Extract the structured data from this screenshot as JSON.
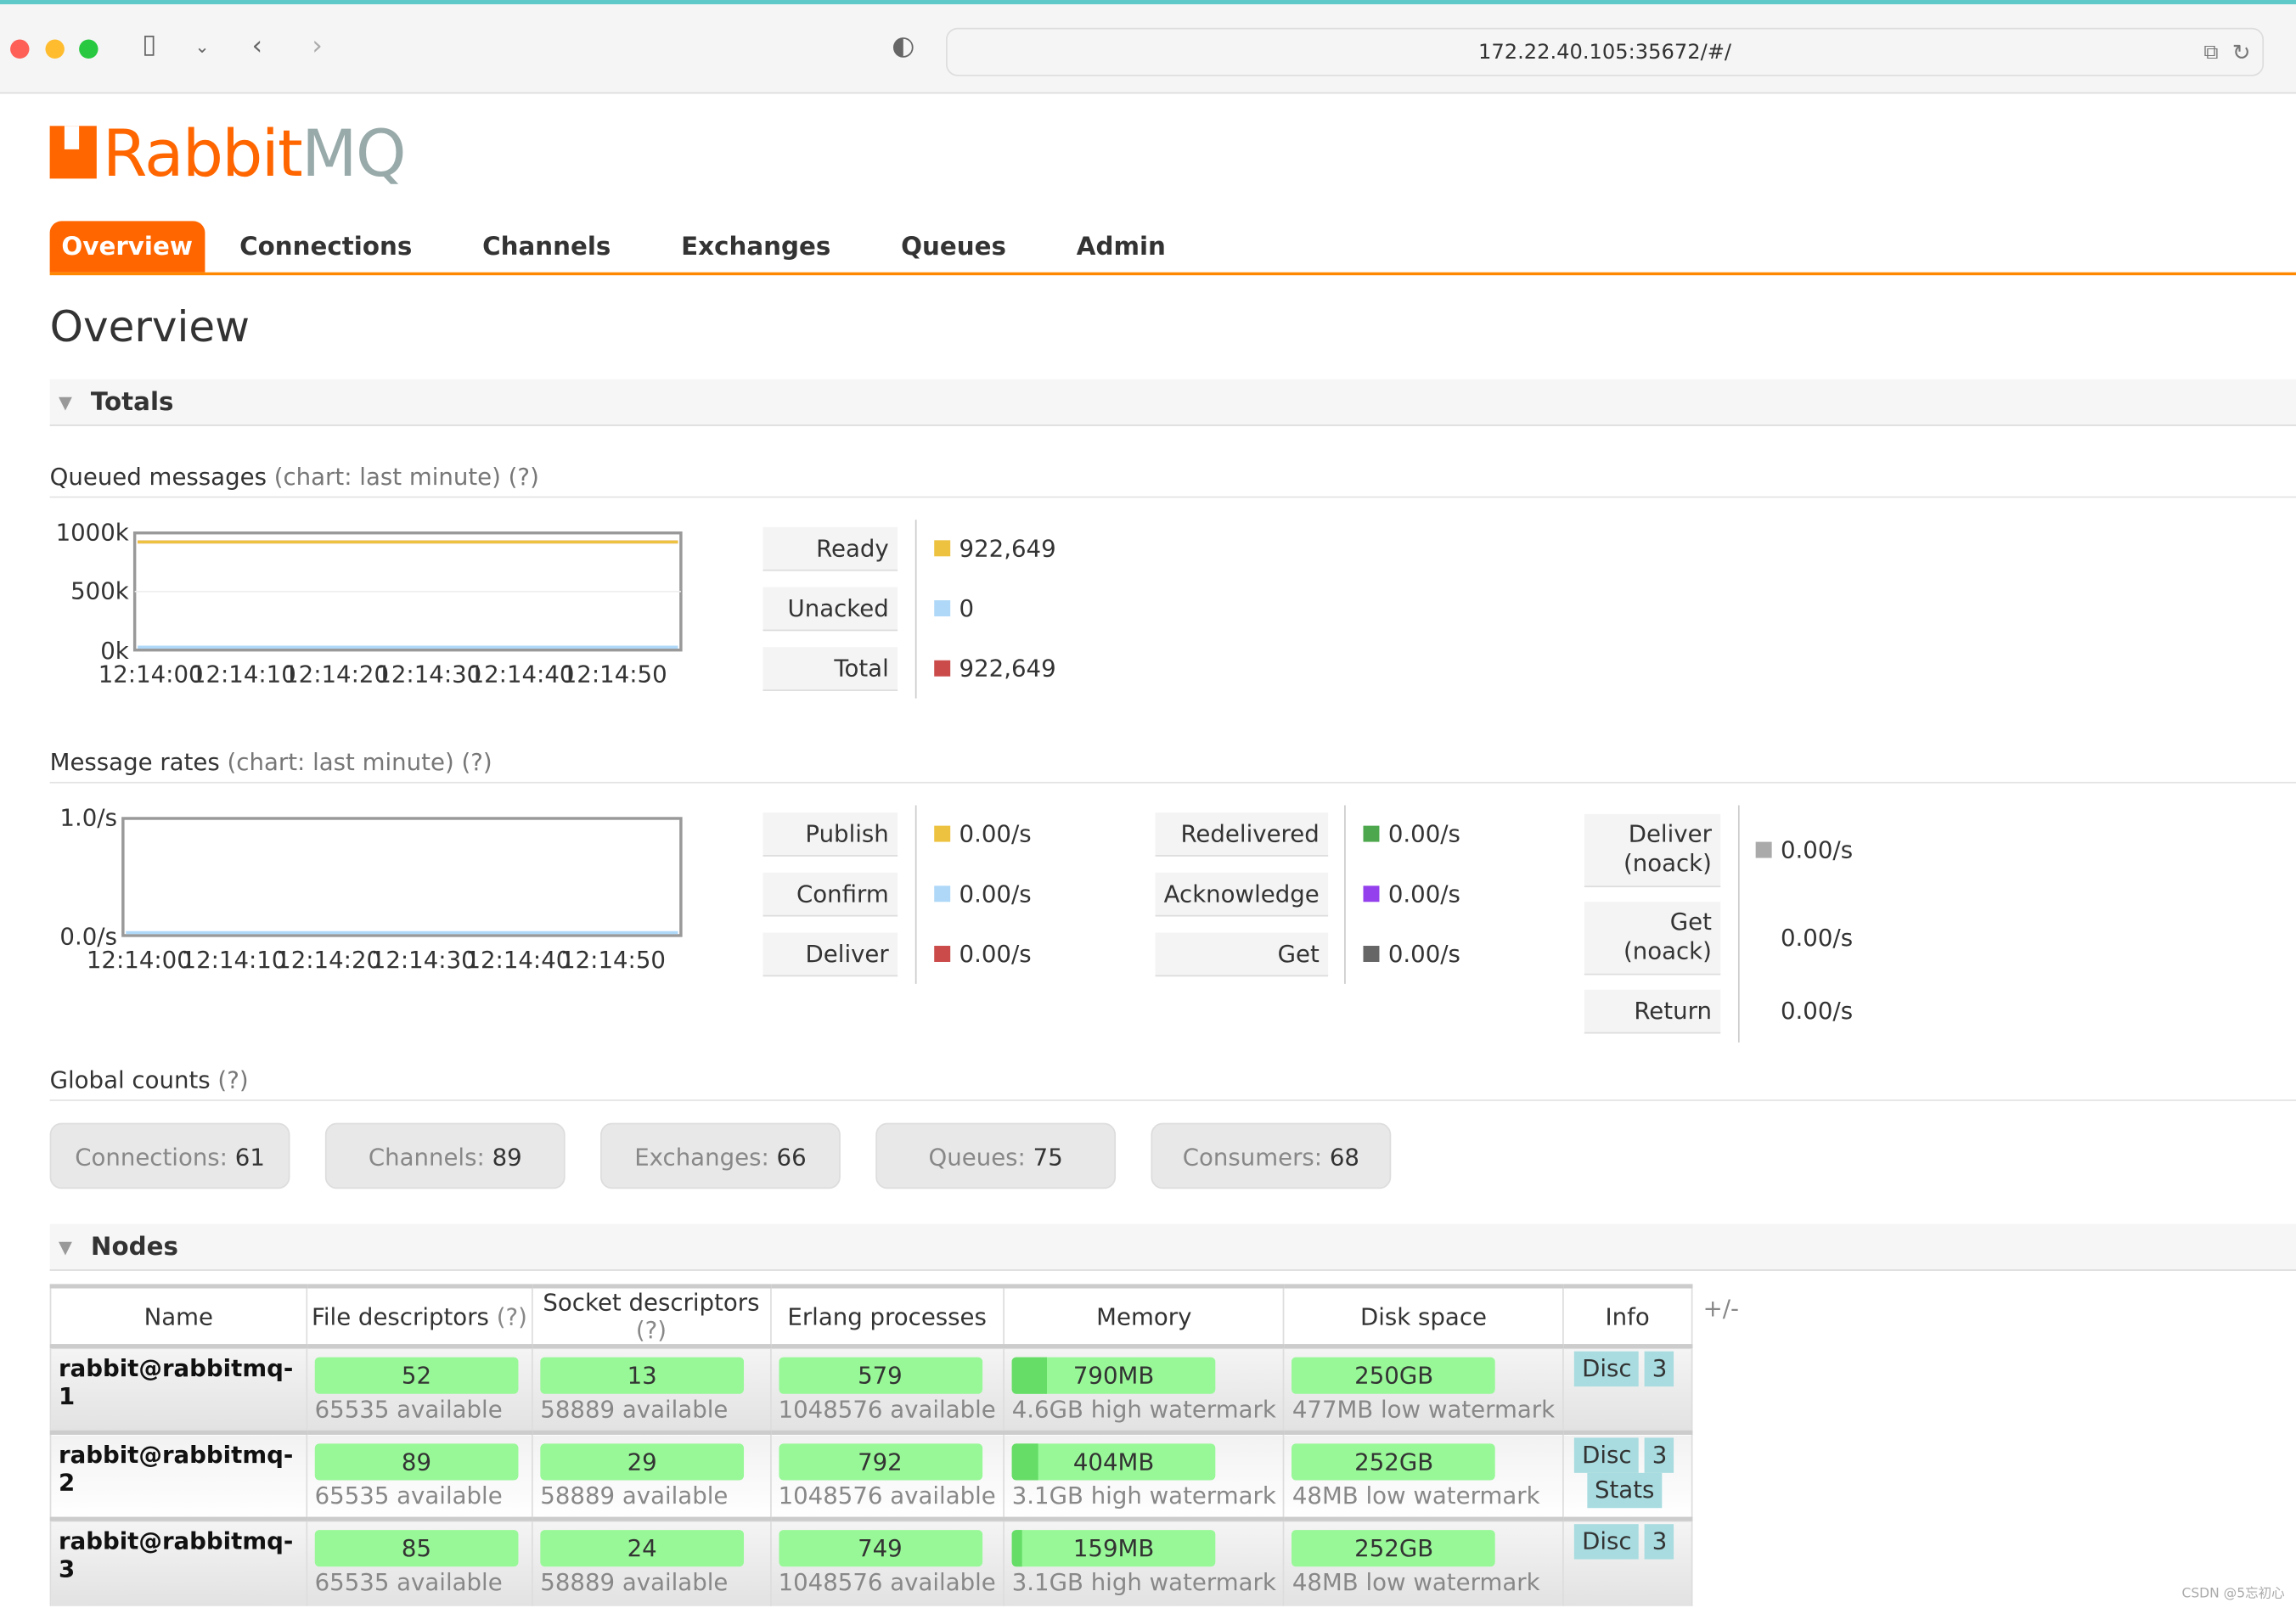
{
  "browser": {
    "url": "172.22.40.105:35672/#/"
  },
  "logo": {
    "text_rabbit": "Rabbit",
    "text_mq": "MQ"
  },
  "nav": {
    "items": [
      "Overview",
      "Connections",
      "Channels",
      "Exchanges",
      "Queues",
      "Admin"
    ],
    "active": "Overview"
  },
  "page_title": "Overview",
  "totals": {
    "title": "Totals",
    "queued": {
      "title": "Queued messages",
      "hint": "(chart: last minute) (?)",
      "legend": [
        {
          "label": "Ready",
          "value": "922,649",
          "color": "#edc240"
        },
        {
          "label": "Unacked",
          "value": "0",
          "color": "#afd8f8"
        },
        {
          "label": "Total",
          "value": "922,649",
          "color": "#cb4b4b"
        }
      ]
    },
    "rates": {
      "title": "Message rates",
      "hint": "(chart: last minute) (?)",
      "col1": [
        {
          "label": "Publish",
          "value": "0.00/s",
          "color": "#edc240"
        },
        {
          "label": "Confirm",
          "value": "0.00/s",
          "color": "#afd8f8"
        },
        {
          "label": "Deliver",
          "value": "0.00/s",
          "color": "#cb4b4b"
        }
      ],
      "col2": [
        {
          "label": "Redelivered",
          "value": "0.00/s",
          "color": "#4da74d"
        },
        {
          "label": "Acknowledge",
          "value": "0.00/s",
          "color": "#9440ed"
        },
        {
          "label": "Get",
          "value": "0.00/s",
          "color": "#666666"
        }
      ],
      "col3": [
        {
          "label": "Deliver\n(noack)",
          "value": "0.00/s",
          "color": "#aaaaaa"
        },
        {
          "label": "Get\n(noack)",
          "value": "0.00/s",
          "color": ""
        },
        {
          "label": "Return",
          "value": "0.00/s",
          "color": ""
        }
      ]
    },
    "global": {
      "title": "Global counts",
      "hint": "(?)",
      "counts": [
        {
          "label": "Connections:",
          "value": "61"
        },
        {
          "label": "Channels:",
          "value": "89"
        },
        {
          "label": "Exchanges:",
          "value": "66"
        },
        {
          "label": "Queues:",
          "value": "75"
        },
        {
          "label": "Consumers:",
          "value": "68"
        }
      ]
    }
  },
  "chart_data": [
    {
      "type": "line",
      "x": [
        "12:14:00",
        "12:14:10",
        "12:14:20",
        "12:14:30",
        "12:14:40",
        "12:14:50"
      ],
      "yticks": [
        "0k",
        "500k",
        "1000k"
      ],
      "ylim": [
        0,
        1000000
      ],
      "series": [
        {
          "name": "Total",
          "color": "#cb4b4b",
          "values": [
            922649,
            922649,
            922649,
            922649,
            922649,
            922649
          ]
        },
        {
          "name": "Ready",
          "color": "#edc240",
          "values": [
            922649,
            922649,
            922649,
            922649,
            922649,
            922649
          ]
        },
        {
          "name": "Unacked",
          "color": "#afd8f8",
          "values": [
            0,
            0,
            0,
            0,
            0,
            0
          ]
        }
      ]
    },
    {
      "type": "line",
      "x": [
        "12:14:00",
        "12:14:10",
        "12:14:20",
        "12:14:30",
        "12:14:40",
        "12:14:50"
      ],
      "yticks": [
        "0.0/s",
        "1.0/s"
      ],
      "ylim": [
        0,
        1
      ],
      "series": [
        {
          "name": "Publish",
          "color": "#afd8f8",
          "values": [
            0,
            0,
            0,
            0,
            0,
            0
          ]
        }
      ]
    }
  ],
  "nodes": {
    "title": "Nodes",
    "plusminus": "+/-",
    "headers": [
      "Name",
      "File descriptors",
      "Socket descriptors",
      "Erlang processes",
      "Memory",
      "Disk space",
      "Info"
    ],
    "help": "(?)",
    "rows": [
      {
        "name": "rabbit@rabbitmq-1",
        "fd": "52",
        "fd_avail": "65535 available",
        "sd": "13",
        "sd_avail": "58889 available",
        "ep": "579",
        "ep_avail": "1048576 available",
        "mem": "790MB",
        "mem_frac": 0.17,
        "mem_wm": "4.6GB high watermark",
        "disk": "250GB",
        "disk_wm": "477MB low watermark",
        "info": [
          "Disc",
          "3"
        ]
      },
      {
        "name": "rabbit@rabbitmq-2",
        "fd": "89",
        "fd_avail": "65535 available",
        "sd": "29",
        "sd_avail": "58889 available",
        "ep": "792",
        "ep_avail": "1048576 available",
        "mem": "404MB",
        "mem_frac": 0.13,
        "mem_wm": "3.1GB high watermark",
        "disk": "252GB",
        "disk_wm": "48MB low watermark",
        "info": [
          "Disc",
          "3",
          "Stats"
        ]
      },
      {
        "name": "rabbit@rabbitmq-3",
        "fd": "85",
        "fd_avail": "65535 available",
        "sd": "24",
        "sd_avail": "58889 available",
        "ep": "749",
        "ep_avail": "1048576 available",
        "mem": "159MB",
        "mem_frac": 0.05,
        "mem_wm": "3.1GB high watermark",
        "disk": "252GB",
        "disk_wm": "48MB low watermark",
        "info": [
          "Disc",
          "3"
        ]
      }
    ]
  },
  "watermark": "CSDN @5忘初心"
}
